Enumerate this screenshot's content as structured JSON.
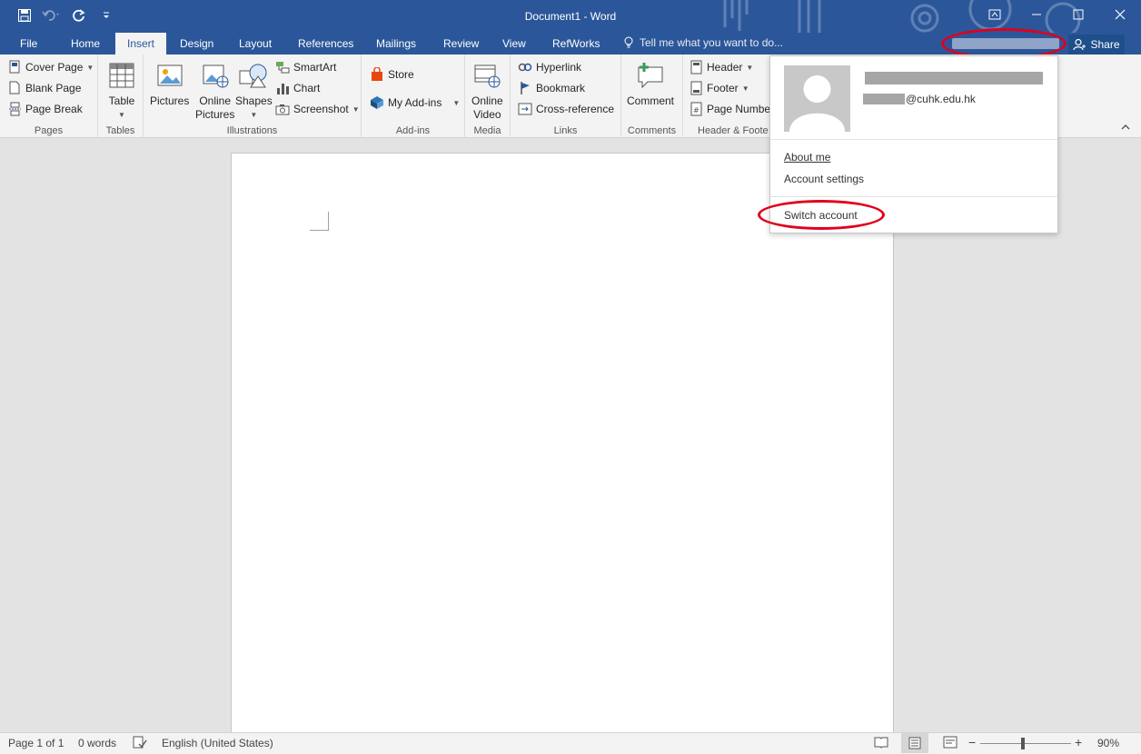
{
  "titlebar": {
    "title": "Document1 - Word",
    "colors": {
      "brand": "#2b579a"
    }
  },
  "tabs": [
    {
      "label": "File"
    },
    {
      "label": "Home"
    },
    {
      "label": "Insert"
    },
    {
      "label": "Design"
    },
    {
      "label": "Layout"
    },
    {
      "label": "References"
    },
    {
      "label": "Mailings"
    },
    {
      "label": "Review"
    },
    {
      "label": "View"
    },
    {
      "label": "RefWorks"
    }
  ],
  "active_tab": "Insert",
  "tell_me": "Tell me what you want to do...",
  "share_label": "Share",
  "ribbon": {
    "pages": {
      "label": "Pages",
      "cover_page": "Cover Page",
      "blank_page": "Blank Page",
      "page_break": "Page Break"
    },
    "tables": {
      "label": "Tables",
      "table": "Table"
    },
    "illustrations": {
      "label": "Illustrations",
      "pictures": "Pictures",
      "online": "Online",
      "online2": "Pictures",
      "shapes": "Shapes",
      "smartart": "SmartArt",
      "chart": "Chart",
      "screenshot": "Screenshot"
    },
    "addins": {
      "label": "Add-ins",
      "store": "Store",
      "my_addins": "My Add-ins"
    },
    "media": {
      "label": "Media",
      "online": "Online",
      "video": "Video"
    },
    "links": {
      "label": "Links",
      "hyperlink": "Hyperlink",
      "bookmark": "Bookmark",
      "crossref": "Cross-reference"
    },
    "comments": {
      "label": "Comments",
      "comment": "Comment"
    },
    "header_footer": {
      "label": "Header & Foote",
      "header": "Header",
      "footer": "Footer",
      "page_number": "Page Numbe"
    }
  },
  "account_menu": {
    "email_domain": "@cuhk.edu.hk",
    "about_me": "About me",
    "account_settings": "Account settings",
    "switch_account": "Switch account"
  },
  "statusbar": {
    "page": "Page 1 of 1",
    "words": "0 words",
    "language": "English (United States)",
    "zoom": "90%"
  }
}
